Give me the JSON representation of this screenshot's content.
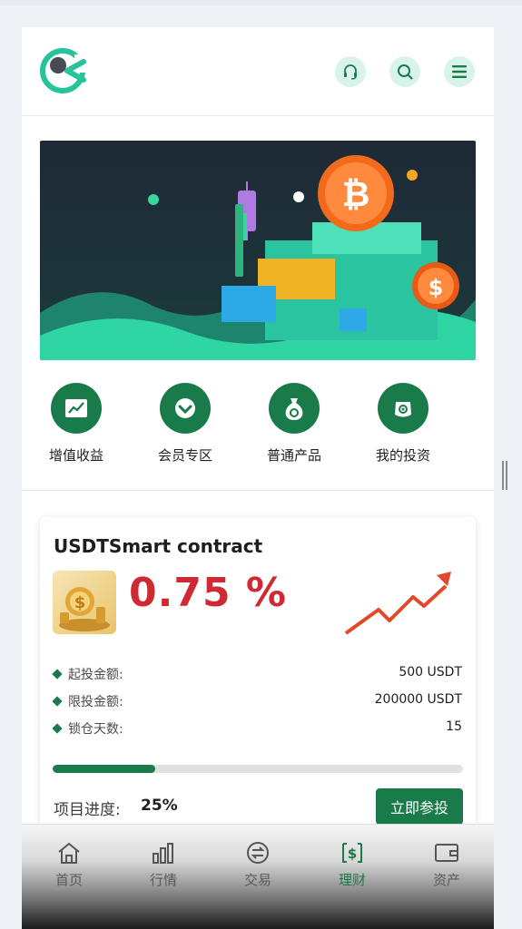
{
  "header": {
    "logo_icon": "brand-logo",
    "icons": [
      "headset-icon",
      "search-icon",
      "menu-icon"
    ]
  },
  "quick_menu": [
    {
      "label": "增值收益",
      "icon": "trend-chart-icon"
    },
    {
      "label": "会员专区",
      "icon": "heart-badge-icon"
    },
    {
      "label": "普通产品",
      "icon": "money-bag-icon"
    },
    {
      "label": "我的投资",
      "icon": "wallet-coin-icon"
    }
  ],
  "product": {
    "title": "USDTSmart contract",
    "rate": "0.75 %",
    "rows": [
      {
        "key": "起投金额:",
        "value": "500 USDT"
      },
      {
        "key": "限投金额:",
        "value": "200000 USDT"
      },
      {
        "key": "锁仓天数:",
        "value": "15"
      }
    ],
    "progress_label": "项目进度:",
    "progress_value": "25%",
    "progress_fraction": 0.25,
    "join_button": "立即参投"
  },
  "nav": [
    {
      "label": "首页",
      "icon": "home-icon"
    },
    {
      "label": "行情",
      "icon": "bar-chart-icon"
    },
    {
      "label": "交易",
      "icon": "exchange-icon"
    },
    {
      "label": "理财",
      "icon": "finance-icon",
      "active": true
    },
    {
      "label": "资产",
      "icon": "wallet-icon"
    }
  ],
  "colors": {
    "primary": "#1a7b4a",
    "accent_red": "#cf2a34",
    "mint": "#d8f4ea"
  }
}
